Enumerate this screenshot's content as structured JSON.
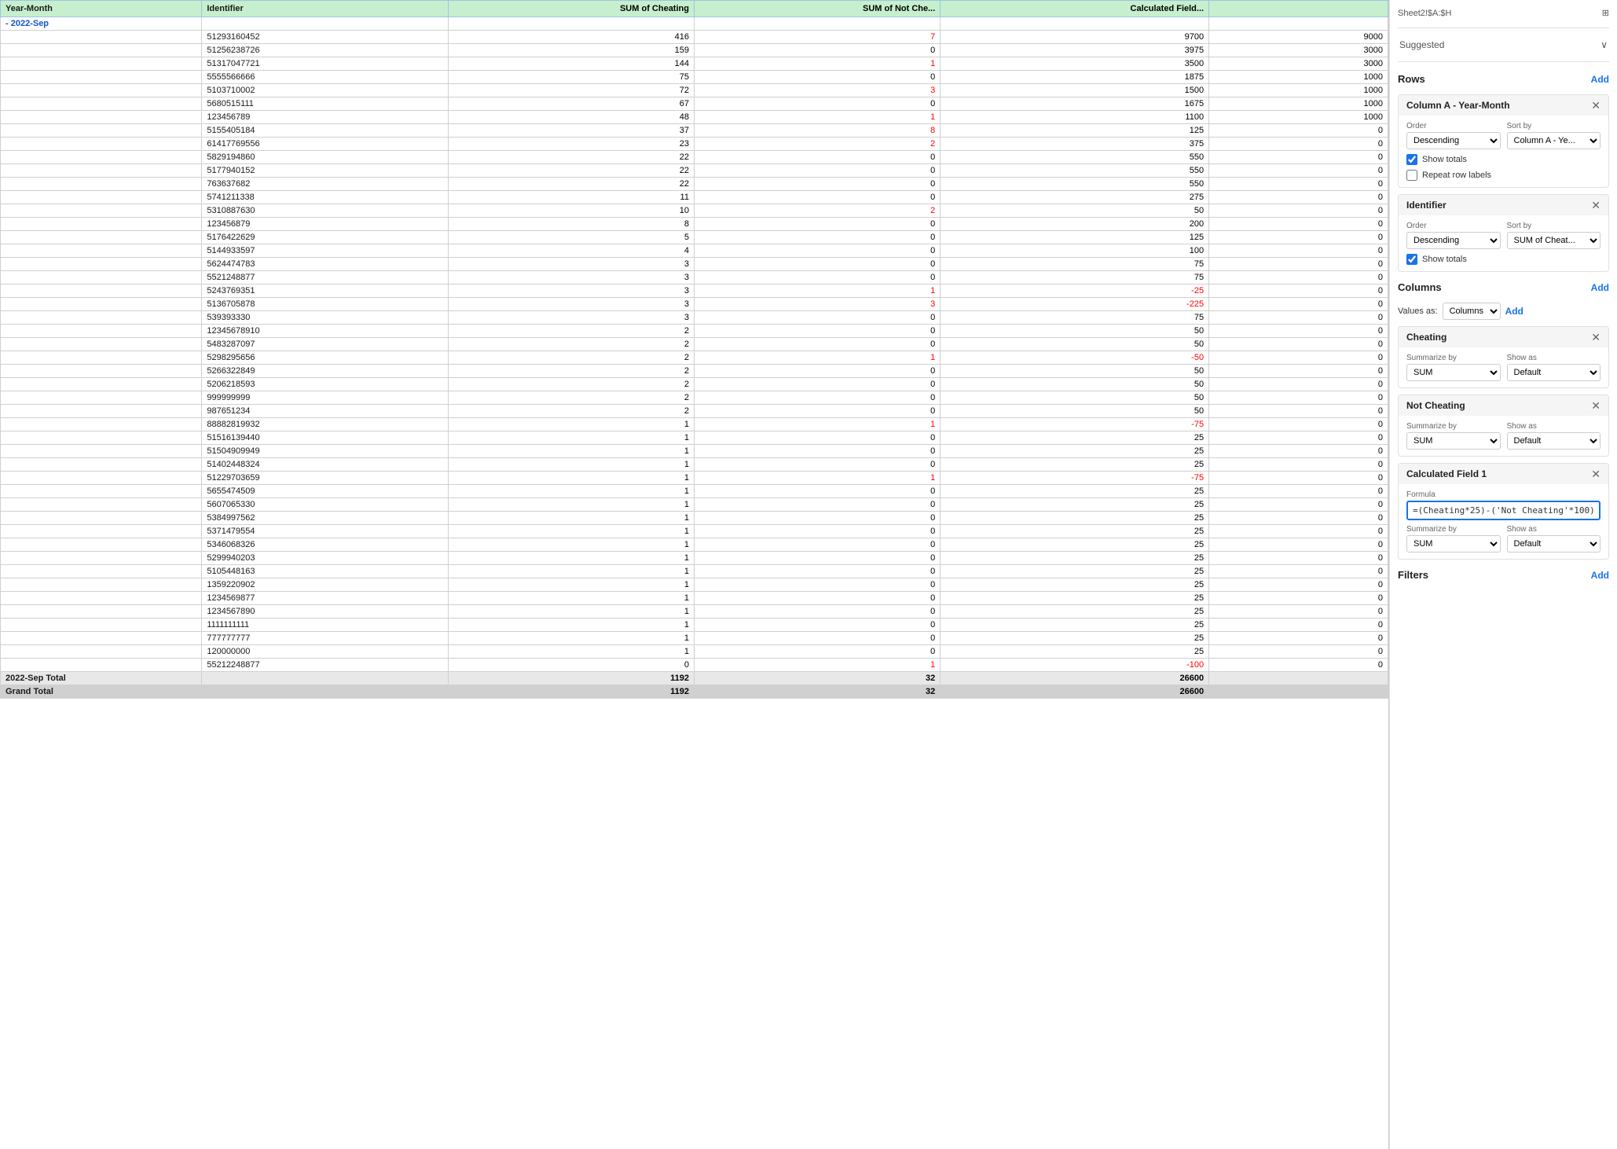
{
  "panel": {
    "sheet_ref": "Sheet2!$A:$H",
    "grid_icon": "⊞",
    "suggested_label": "Suggested",
    "suggested_chevron": "∨",
    "rows_label": "Rows",
    "add_label": "Add",
    "columns_label": "Columns",
    "filters_label": "Filters",
    "values_as_label": "Values as:",
    "values_as_value": "Columns",
    "col_a_year_month": {
      "title": "Column A - Year-Month",
      "order_label": "Order",
      "order_value": "Descending",
      "sort_by_label": "Sort by",
      "sort_by_value": "Column A - Ye...",
      "show_totals_label": "Show totals",
      "show_totals_checked": true,
      "repeat_row_labels_label": "Repeat row labels",
      "repeat_row_labels_checked": false
    },
    "identifier": {
      "title": "Identifier",
      "order_label": "Order",
      "order_value": "Descending",
      "sort_by_label": "Sort by",
      "sort_by_value": "SUM of Cheat...",
      "show_totals_label": "Show totals",
      "show_totals_checked": true
    },
    "cheating": {
      "title": "Cheating",
      "summarize_by_label": "Summarize by",
      "summarize_by_value": "SUM",
      "show_as_label": "Show as",
      "show_as_value": "Default"
    },
    "not_cheating": {
      "title": "Not Cheating",
      "summarize_by_label": "Summarize by",
      "summarize_by_value": "SUM",
      "show_as_label": "Show as",
      "show_as_value": "Default"
    },
    "calculated_field_1": {
      "title": "Calculated Field 1",
      "formula_label": "Formula",
      "formula_value": "=(Cheating*25)-('Not Cheating'*100)",
      "summarize_by_label": "Summarize by",
      "summarize_by_value": "SUM",
      "show_as_label": "Show as",
      "show_as_value": "Default"
    }
  },
  "table": {
    "headers": [
      "Year-Month",
      "Identifier",
      "SUM of Cheating",
      "SUM of Not Che...",
      "Calculated Field...",
      ""
    ],
    "group_label": "- 2022-Sep",
    "rows": [
      {
        "year_month": "",
        "identifier": "51293160452",
        "cheating": "416",
        "not_cheating": "7",
        "calc": "9700",
        "extra": "9000"
      },
      {
        "year_month": "",
        "identifier": "51256238726",
        "cheating": "159",
        "not_cheating": "0",
        "calc": "3975",
        "extra": "3000"
      },
      {
        "year_month": "",
        "identifier": "51317047721",
        "cheating": "144",
        "not_cheating": "1",
        "calc": "3500",
        "extra": "3000"
      },
      {
        "year_month": "",
        "identifier": "5555566666",
        "cheating": "75",
        "not_cheating": "0",
        "calc": "1875",
        "extra": "1000"
      },
      {
        "year_month": "",
        "identifier": "5103710002",
        "cheating": "72",
        "not_cheating": "3",
        "calc": "1500",
        "extra": "1000"
      },
      {
        "year_month": "",
        "identifier": "5680515111",
        "cheating": "67",
        "not_cheating": "0",
        "calc": "1675",
        "extra": "1000"
      },
      {
        "year_month": "",
        "identifier": "123456789",
        "cheating": "48",
        "not_cheating": "1",
        "calc": "1100",
        "extra": "1000"
      },
      {
        "year_month": "",
        "identifier": "5155405184",
        "cheating": "37",
        "not_cheating": "8",
        "calc": "125",
        "extra": "0"
      },
      {
        "year_month": "",
        "identifier": "61417769556",
        "cheating": "23",
        "not_cheating": "2",
        "calc": "375",
        "extra": "0"
      },
      {
        "year_month": "",
        "identifier": "5829194860",
        "cheating": "22",
        "not_cheating": "0",
        "calc": "550",
        "extra": "0"
      },
      {
        "year_month": "",
        "identifier": "5177940152",
        "cheating": "22",
        "not_cheating": "0",
        "calc": "550",
        "extra": "0"
      },
      {
        "year_month": "",
        "identifier": "763637682",
        "cheating": "22",
        "not_cheating": "0",
        "calc": "550",
        "extra": "0"
      },
      {
        "year_month": "",
        "identifier": "5741211338",
        "cheating": "11",
        "not_cheating": "0",
        "calc": "275",
        "extra": "0"
      },
      {
        "year_month": "",
        "identifier": "5310887630",
        "cheating": "10",
        "not_cheating": "2",
        "calc": "50",
        "extra": "0"
      },
      {
        "year_month": "",
        "identifier": "123456879",
        "cheating": "8",
        "not_cheating": "0",
        "calc": "200",
        "extra": "0"
      },
      {
        "year_month": "",
        "identifier": "5176422629",
        "cheating": "5",
        "not_cheating": "0",
        "calc": "125",
        "extra": "0"
      },
      {
        "year_month": "",
        "identifier": "5144933597",
        "cheating": "4",
        "not_cheating": "0",
        "calc": "100",
        "extra": "0"
      },
      {
        "year_month": "",
        "identifier": "5624474783",
        "cheating": "3",
        "not_cheating": "0",
        "calc": "75",
        "extra": "0"
      },
      {
        "year_month": "",
        "identifier": "5521248877",
        "cheating": "3",
        "not_cheating": "0",
        "calc": "75",
        "extra": "0"
      },
      {
        "year_month": "",
        "identifier": "5243769351",
        "cheating": "3",
        "not_cheating": "1",
        "calc": "-25",
        "extra": "0",
        "negative": true
      },
      {
        "year_month": "",
        "identifier": "5136705878",
        "cheating": "3",
        "not_cheating": "3",
        "calc": "-225",
        "extra": "0",
        "negative": true
      },
      {
        "year_month": "",
        "identifier": "539393330",
        "cheating": "3",
        "not_cheating": "0",
        "calc": "75",
        "extra": "0"
      },
      {
        "year_month": "",
        "identifier": "12345678910",
        "cheating": "2",
        "not_cheating": "0",
        "calc": "50",
        "extra": "0"
      },
      {
        "year_month": "",
        "identifier": "5483287097",
        "cheating": "2",
        "not_cheating": "0",
        "calc": "50",
        "extra": "0"
      },
      {
        "year_month": "",
        "identifier": "5298295656",
        "cheating": "2",
        "not_cheating": "1",
        "calc": "-50",
        "extra": "0",
        "negative": true
      },
      {
        "year_month": "",
        "identifier": "5266322849",
        "cheating": "2",
        "not_cheating": "0",
        "calc": "50",
        "extra": "0"
      },
      {
        "year_month": "",
        "identifier": "5206218593",
        "cheating": "2",
        "not_cheating": "0",
        "calc": "50",
        "extra": "0"
      },
      {
        "year_month": "",
        "identifier": "999999999",
        "cheating": "2",
        "not_cheating": "0",
        "calc": "50",
        "extra": "0"
      },
      {
        "year_month": "",
        "identifier": "987651234",
        "cheating": "2",
        "not_cheating": "0",
        "calc": "50",
        "extra": "0"
      },
      {
        "year_month": "",
        "identifier": "88882819932",
        "cheating": "1",
        "not_cheating": "1",
        "calc": "-75",
        "extra": "0",
        "negative": true
      },
      {
        "year_month": "",
        "identifier": "51516139440",
        "cheating": "1",
        "not_cheating": "0",
        "calc": "25",
        "extra": "0"
      },
      {
        "year_month": "",
        "identifier": "51504909949",
        "cheating": "1",
        "not_cheating": "0",
        "calc": "25",
        "extra": "0"
      },
      {
        "year_month": "",
        "identifier": "51402448324",
        "cheating": "1",
        "not_cheating": "0",
        "calc": "25",
        "extra": "0"
      },
      {
        "year_month": "",
        "identifier": "51229703659",
        "cheating": "1",
        "not_cheating": "1",
        "calc": "-75",
        "extra": "0",
        "negative": true
      },
      {
        "year_month": "",
        "identifier": "5655474509",
        "cheating": "1",
        "not_cheating": "0",
        "calc": "25",
        "extra": "0"
      },
      {
        "year_month": "",
        "identifier": "5607065330",
        "cheating": "1",
        "not_cheating": "0",
        "calc": "25",
        "extra": "0"
      },
      {
        "year_month": "",
        "identifier": "5384997562",
        "cheating": "1",
        "not_cheating": "0",
        "calc": "25",
        "extra": "0"
      },
      {
        "year_month": "",
        "identifier": "5371479554",
        "cheating": "1",
        "not_cheating": "0",
        "calc": "25",
        "extra": "0"
      },
      {
        "year_month": "",
        "identifier": "5346068326",
        "cheating": "1",
        "not_cheating": "0",
        "calc": "25",
        "extra": "0"
      },
      {
        "year_month": "",
        "identifier": "5299940203",
        "cheating": "1",
        "not_cheating": "0",
        "calc": "25",
        "extra": "0"
      },
      {
        "year_month": "",
        "identifier": "5105448163",
        "cheating": "1",
        "not_cheating": "0",
        "calc": "25",
        "extra": "0"
      },
      {
        "year_month": "",
        "identifier": "1359220902",
        "cheating": "1",
        "not_cheating": "0",
        "calc": "25",
        "extra": "0"
      },
      {
        "year_month": "",
        "identifier": "1234569877",
        "cheating": "1",
        "not_cheating": "0",
        "calc": "25",
        "extra": "0"
      },
      {
        "year_month": "",
        "identifier": "1234567890",
        "cheating": "1",
        "not_cheating": "0",
        "calc": "25",
        "extra": "0"
      },
      {
        "year_month": "",
        "identifier": "1111111111",
        "cheating": "1",
        "not_cheating": "0",
        "calc": "25",
        "extra": "0"
      },
      {
        "year_month": "",
        "identifier": "777777777",
        "cheating": "1",
        "not_cheating": "0",
        "calc": "25",
        "extra": "0"
      },
      {
        "year_month": "",
        "identifier": "120000000",
        "cheating": "1",
        "not_cheating": "0",
        "calc": "25",
        "extra": "0"
      },
      {
        "year_month": "",
        "identifier": "55212248877",
        "cheating": "0",
        "not_cheating": "1",
        "calc": "-100",
        "extra": "0",
        "negative": true
      }
    ],
    "total_row": {
      "label": "2022-Sep Total",
      "cheating": "1192",
      "not_cheating": "32",
      "calc": "26600"
    },
    "grand_total_row": {
      "label": "Grand Total",
      "cheating": "1192",
      "not_cheating": "32",
      "calc": "26600"
    }
  }
}
